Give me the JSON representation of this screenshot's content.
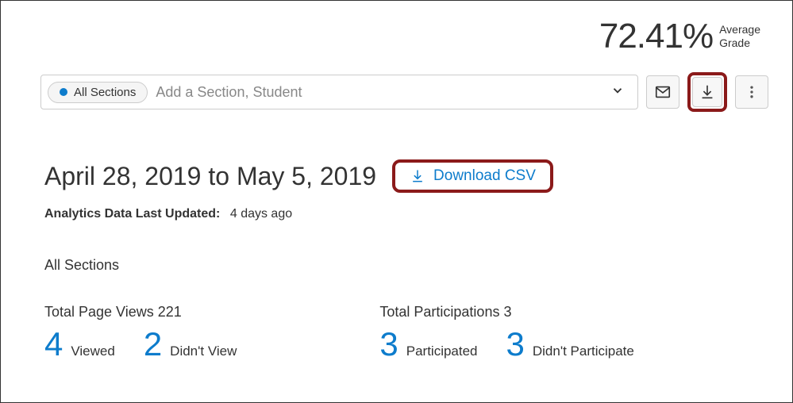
{
  "headerStat": {
    "value": "72.41%",
    "labelLine1": "Average",
    "labelLine2": "Grade"
  },
  "filter": {
    "pillLabel": "All Sections",
    "placeholder": "Add a Section, Student"
  },
  "dateRange": "April 28, 2019 to May 5, 2019",
  "csvLabel": "Download CSV",
  "updated": {
    "label": "Analytics Data Last Updated:",
    "value": "4 days ago"
  },
  "sectionTitle": "All Sections",
  "pageViews": {
    "heading": "Total Page Views 221",
    "viewedNum": "4",
    "viewedLabel": "Viewed",
    "didntNum": "2",
    "didntLabel": "Didn't View"
  },
  "participations": {
    "heading": "Total Participations 3",
    "partNum": "3",
    "partLabel": "Participated",
    "didntNum": "3",
    "didntLabel": "Didn't Participate"
  }
}
